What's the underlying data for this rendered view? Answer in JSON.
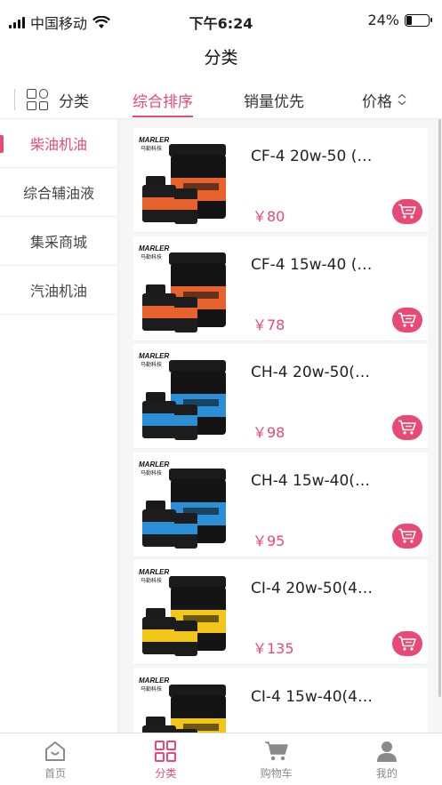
{
  "status_bar": {
    "carrier": "中国移动",
    "time": "下午6:24",
    "battery": "24%"
  },
  "nav": {
    "title": "分类"
  },
  "filter_bar": {
    "category_label": "分类",
    "tabs": [
      {
        "label": "综合排序",
        "active": true
      },
      {
        "label": "销量优先",
        "active": false
      },
      {
        "label": "价格",
        "active": false
      }
    ]
  },
  "sidebar": {
    "items": [
      {
        "label": "柴油机油",
        "active": true
      },
      {
        "label": "综合辅油液",
        "active": false
      },
      {
        "label": "集采商城",
        "active": false
      },
      {
        "label": "汽油机油",
        "active": false
      }
    ]
  },
  "products": [
    {
      "name": "CF-4 20w-50 (…",
      "price": "￥80",
      "brand": "MARLER",
      "brand_sub": "马勒科技",
      "label_color": "#e8632b"
    },
    {
      "name": "CF-4 15w-40 (…",
      "price": "￥78",
      "brand": "MARLER",
      "brand_sub": "马勒科技",
      "label_color": "#e8632b"
    },
    {
      "name": "CH-4 20w-50(…",
      "price": "￥98",
      "brand": "MARLER",
      "brand_sub": "马勒科技",
      "label_color": "#2a8fd6"
    },
    {
      "name": "CH-4 15w-40(…",
      "price": "￥95",
      "brand": "MARLER",
      "brand_sub": "马勒科技",
      "label_color": "#2a8fd6"
    },
    {
      "name": "CI-4 20w-50(4…",
      "price": "￥135",
      "brand": "MARLER",
      "brand_sub": "马勒科技",
      "label_color": "#f2c618"
    },
    {
      "name": "CI-4 15w-40(4…",
      "price": "",
      "brand": "MARLER",
      "brand_sub": "马勒科技",
      "label_color": "#f2c618"
    }
  ],
  "tabbar": {
    "items": [
      {
        "label": "首页",
        "icon": "home-icon",
        "active": false
      },
      {
        "label": "分类",
        "icon": "category-icon",
        "active": true
      },
      {
        "label": "购物车",
        "icon": "cart-icon",
        "active": false
      },
      {
        "label": "我的",
        "icon": "user-icon",
        "active": false
      }
    ]
  },
  "colors": {
    "accent": "#e84a75"
  }
}
